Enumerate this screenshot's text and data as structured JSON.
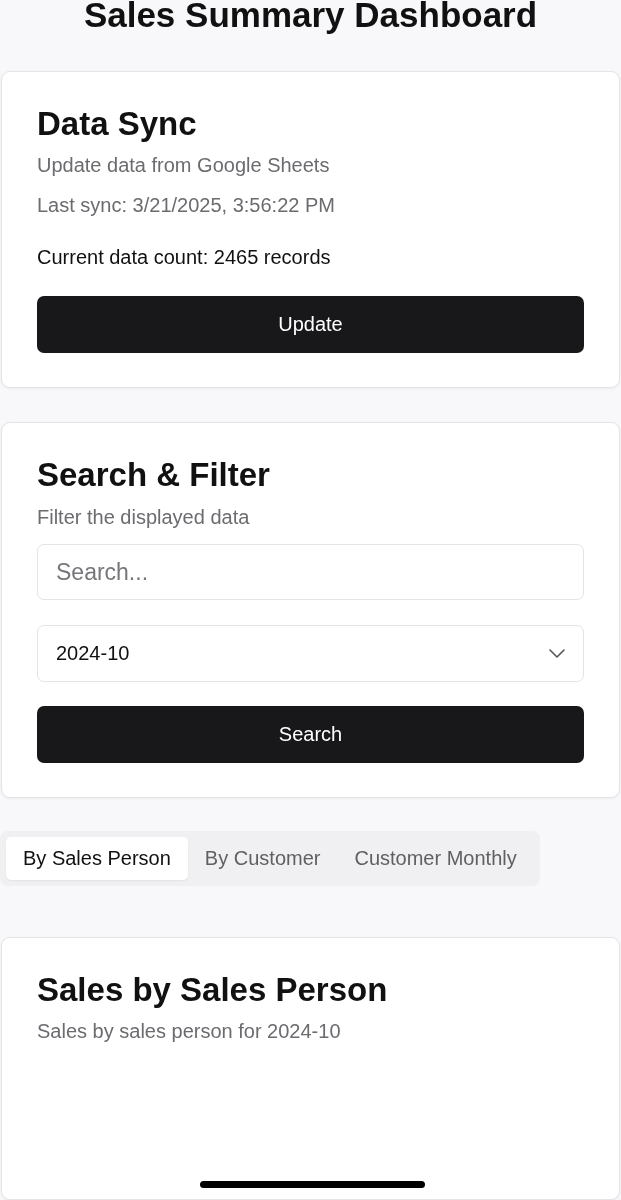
{
  "page_title": "Sales Summary Dashboard",
  "data_sync": {
    "title": "Data Sync",
    "subtitle": "Update data from Google Sheets",
    "last_sync": "Last sync: 3/21/2025, 3:56:22 PM",
    "record_count": "Current data count: 2465 records",
    "button": "Update"
  },
  "search_filter": {
    "title": "Search & Filter",
    "subtitle": "Filter the displayed data",
    "search": {
      "placeholder": "Search..."
    },
    "month_select": {
      "value": "2024-10"
    },
    "button": "Search"
  },
  "tabs": [
    {
      "label": "By Sales Person",
      "selected": true
    },
    {
      "label": "By Customer",
      "selected": false
    },
    {
      "label": "Customer Monthly",
      "selected": false
    }
  ],
  "sales_panel": {
    "title": "Sales by Sales Person",
    "subtitle": "Sales by sales person for 2024-10"
  }
}
